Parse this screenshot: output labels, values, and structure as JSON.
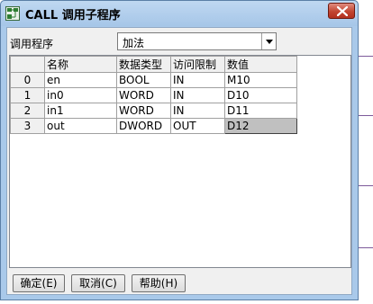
{
  "window": {
    "title": "CALL 调用子程序"
  },
  "icons": {
    "app": "block-diagram-icon",
    "close": "close-icon",
    "dropdown": "chevron-down-icon"
  },
  "colors": {
    "titlebar": "#a9c9ea",
    "close_button": "#c24531",
    "selected_cell": "#c0c0c0"
  },
  "program": {
    "label": "调用程序",
    "selected": "加法"
  },
  "table": {
    "headers": [
      "",
      "名称",
      "数据类型",
      "访问限制",
      "数值"
    ],
    "rows": [
      {
        "index": "0",
        "name": "en",
        "type": "BOOL",
        "access": "IN",
        "value": "M10"
      },
      {
        "index": "1",
        "name": "in0",
        "type": "WORD",
        "access": "IN",
        "value": "D10"
      },
      {
        "index": "2",
        "name": "in1",
        "type": "WORD",
        "access": "IN",
        "value": "D11"
      },
      {
        "index": "3",
        "name": "out",
        "type": "DWORD",
        "access": "OUT",
        "value": "D12"
      }
    ]
  },
  "buttons": {
    "ok": "确定(E)",
    "cancel": "取消(C)",
    "help": "帮助(H)"
  }
}
